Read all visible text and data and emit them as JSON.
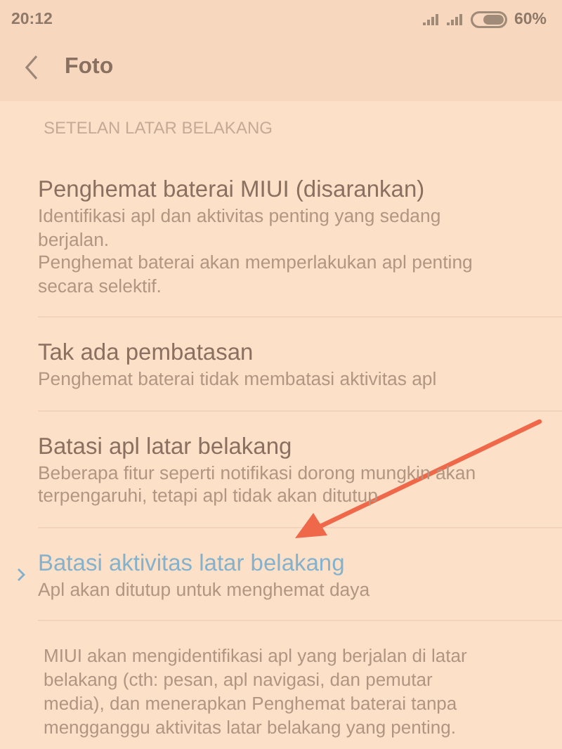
{
  "status_bar": {
    "time": "20:12",
    "battery": "60%"
  },
  "header": {
    "title": "Foto"
  },
  "section_title": "SETELAN LATAR BELAKANG",
  "options": [
    {
      "title": "Penghemat baterai MIUI (disarankan)",
      "description": "Identifikasi apl dan aktivitas penting yang sedang berjalan.\nPenghemat baterai akan memperlakukan apl penting secara selektif.",
      "selected": false
    },
    {
      "title": "Tak ada pembatasan",
      "description": "Penghemat baterai tidak membatasi aktivitas apl",
      "selected": false
    },
    {
      "title": "Batasi apl latar belakang",
      "description": "Beberapa fitur seperti notifikasi dorong mungkin akan terpengaruhi, tetapi apl tidak akan ditutup",
      "selected": false
    },
    {
      "title": "Batasi aktivitas latar belakang",
      "description": "Apl akan ditutup untuk menghemat daya",
      "selected": true
    }
  ],
  "footer_note": "MIUI akan mengidentifikasi apl yang berjalan di latar belakang (cth: pesan, apl navigasi, dan pemutar media), dan menerapkan Penghemat baterai tanpa mengganggu aktivitas latar belakang yang penting."
}
